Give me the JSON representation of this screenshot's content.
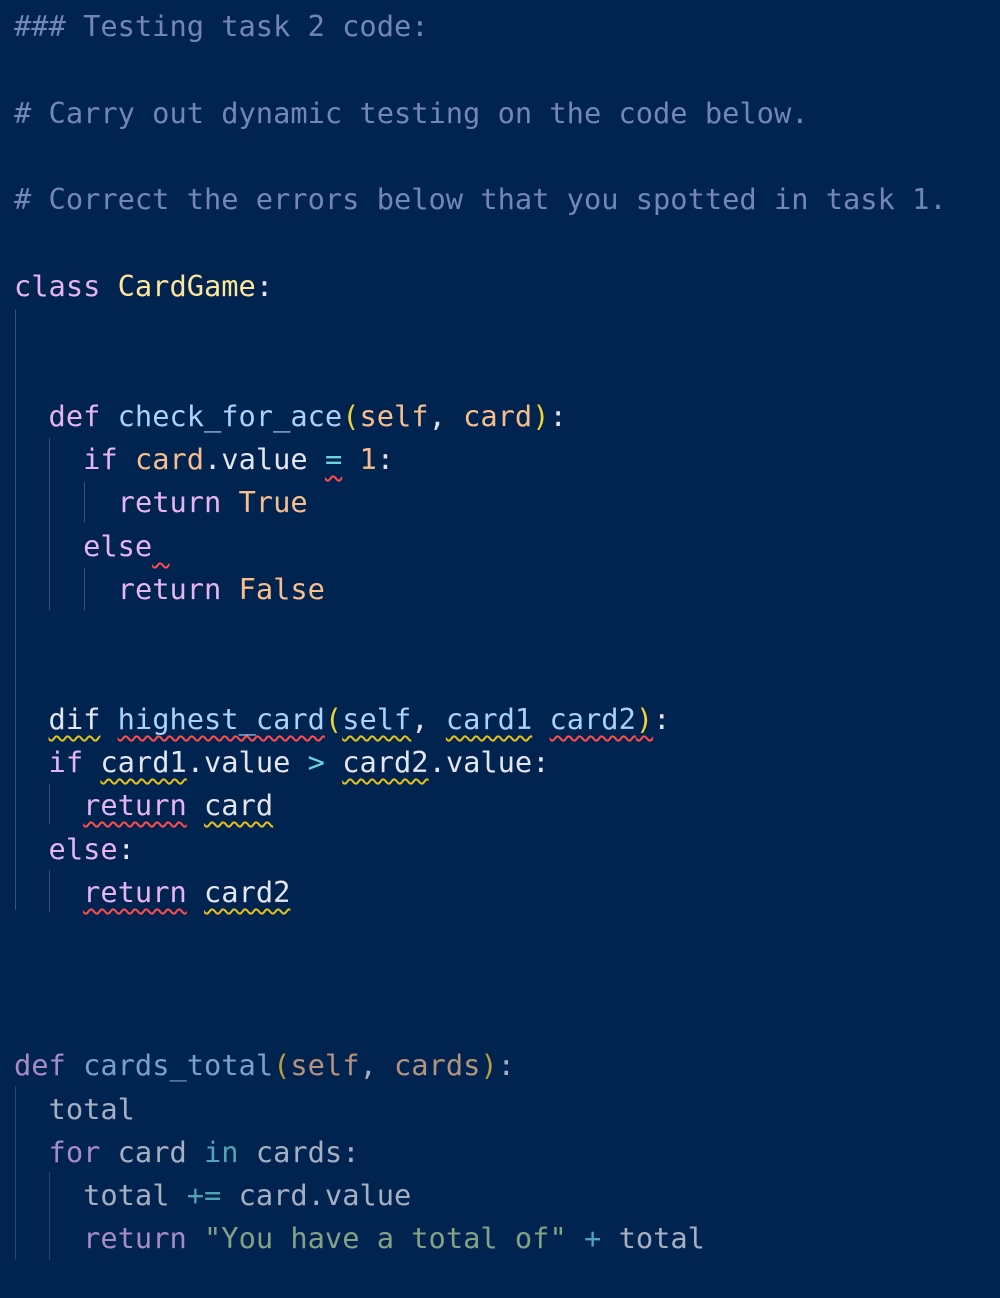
{
  "editor": {
    "lines": [
      {
        "row": 0,
        "indent": 0,
        "tokens": [
          {
            "t": "### Testing task 2 code:",
            "k": "comment"
          }
        ]
      },
      {
        "row": 2,
        "indent": 0,
        "tokens": [
          {
            "t": "# Carry out dynamic testing on the code below.",
            "k": "comment"
          }
        ]
      },
      {
        "row": 4,
        "indent": 0,
        "tokens": [
          {
            "t": "# Correct the errors below that you spotted in task 1.",
            "k": "comment"
          }
        ]
      },
      {
        "row": 6,
        "indent": 0,
        "tokens": [
          {
            "t": "class",
            "k": "kw"
          },
          {
            "t": " ",
            "k": "plain"
          },
          {
            "t": "CardGame",
            "k": "cls"
          },
          {
            "t": ":",
            "k": "plain"
          }
        ]
      },
      {
        "row": 9,
        "indent": 2,
        "tokens": [
          {
            "t": "def",
            "k": "kw"
          },
          {
            "t": " ",
            "k": "plain"
          },
          {
            "t": "check_for_ace",
            "k": "fn"
          },
          {
            "t": "(",
            "k": "paren"
          },
          {
            "t": "self",
            "k": "param"
          },
          {
            "t": ", ",
            "k": "plain"
          },
          {
            "t": "card",
            "k": "param"
          },
          {
            "t": ")",
            "k": "paren"
          },
          {
            "t": ":",
            "k": "plain"
          }
        ]
      },
      {
        "row": 10,
        "indent": 4,
        "tokens": [
          {
            "t": "if",
            "k": "kw"
          },
          {
            "t": " ",
            "k": "plain"
          },
          {
            "t": "card",
            "k": "param"
          },
          {
            "t": ".value ",
            "k": "plain"
          },
          {
            "t": "=",
            "k": "op",
            "d": "err"
          },
          {
            "t": " ",
            "k": "plain"
          },
          {
            "t": "1",
            "k": "num"
          },
          {
            "t": ":",
            "k": "plain"
          }
        ]
      },
      {
        "row": 11,
        "indent": 6,
        "tokens": [
          {
            "t": "return",
            "k": "kw"
          },
          {
            "t": " ",
            "k": "plain"
          },
          {
            "t": "True",
            "k": "const"
          }
        ]
      },
      {
        "row": 12,
        "indent": 4,
        "tokens": [
          {
            "t": "else",
            "k": "kw"
          },
          {
            "t": " ",
            "k": "plain",
            "d": "err"
          }
        ]
      },
      {
        "row": 13,
        "indent": 6,
        "tokens": [
          {
            "t": "return",
            "k": "kw"
          },
          {
            "t": " ",
            "k": "plain"
          },
          {
            "t": "False",
            "k": "const"
          }
        ]
      },
      {
        "row": 16,
        "indent": 2,
        "tokens": [
          {
            "t": "dif",
            "k": "plain",
            "d": "warn"
          },
          {
            "t": " ",
            "k": "plain"
          },
          {
            "t": "highest_card",
            "k": "fn",
            "d": "err"
          },
          {
            "t": "(",
            "k": "paren"
          },
          {
            "t": "self",
            "k": "fn",
            "d": "warn"
          },
          {
            "t": ", ",
            "k": "plain"
          },
          {
            "t": "card1",
            "k": "fn",
            "d": "warn"
          },
          {
            "t": " ",
            "k": "plain"
          },
          {
            "t": "card2",
            "k": "fn",
            "d": "err"
          },
          {
            "t": ")",
            "k": "paren",
            "d": "err"
          },
          {
            "t": ":",
            "k": "plain"
          }
        ]
      },
      {
        "row": 17,
        "indent": 2,
        "tokens": [
          {
            "t": "if",
            "k": "kw"
          },
          {
            "t": " ",
            "k": "plain"
          },
          {
            "t": "card1",
            "k": "plain",
            "d": "warn"
          },
          {
            "t": ".value ",
            "k": "plain"
          },
          {
            "t": ">",
            "k": "op"
          },
          {
            "t": " ",
            "k": "plain"
          },
          {
            "t": "card2",
            "k": "plain",
            "d": "warn"
          },
          {
            "t": ".value:",
            "k": "plain"
          }
        ]
      },
      {
        "row": 18,
        "indent": 4,
        "tokens": [
          {
            "t": "return",
            "k": "kw",
            "d": "err"
          },
          {
            "t": " ",
            "k": "plain"
          },
          {
            "t": "card",
            "k": "plain",
            "d": "warn"
          }
        ]
      },
      {
        "row": 19,
        "indent": 2,
        "tokens": [
          {
            "t": "else",
            "k": "kw"
          },
          {
            "t": ":",
            "k": "plain"
          }
        ]
      },
      {
        "row": 20,
        "indent": 4,
        "tokens": [
          {
            "t": "return",
            "k": "kw",
            "d": "err"
          },
          {
            "t": " ",
            "k": "plain"
          },
          {
            "t": "card2",
            "k": "plain",
            "d": "warn"
          }
        ]
      },
      {
        "row": 24,
        "indent": 0,
        "dim": true,
        "tokens": [
          {
            "t": "def",
            "k": "kw"
          },
          {
            "t": " ",
            "k": "plain"
          },
          {
            "t": "cards_total",
            "k": "fn"
          },
          {
            "t": "(",
            "k": "paren"
          },
          {
            "t": "self",
            "k": "param"
          },
          {
            "t": ", ",
            "k": "plain"
          },
          {
            "t": "cards",
            "k": "param"
          },
          {
            "t": ")",
            "k": "paren"
          },
          {
            "t": ":",
            "k": "plain"
          }
        ]
      },
      {
        "row": 25,
        "indent": 2,
        "dim": true,
        "tokens": [
          {
            "t": "total",
            "k": "plain"
          }
        ]
      },
      {
        "row": 26,
        "indent": 2,
        "dim": true,
        "tokens": [
          {
            "t": "for",
            "k": "kw"
          },
          {
            "t": " card ",
            "k": "plain"
          },
          {
            "t": "in",
            "k": "op"
          },
          {
            "t": " cards:",
            "k": "plain"
          }
        ]
      },
      {
        "row": 27,
        "indent": 4,
        "dim": true,
        "tokens": [
          {
            "t": "total ",
            "k": "plain"
          },
          {
            "t": "+=",
            "k": "op"
          },
          {
            "t": " card.value",
            "k": "plain"
          }
        ]
      },
      {
        "row": 28,
        "indent": 4,
        "dim": true,
        "tokens": [
          {
            "t": "return",
            "k": "kw"
          },
          {
            "t": " ",
            "k": "plain"
          },
          {
            "t": "\"You have a total of\"",
            "k": "str"
          },
          {
            "t": " ",
            "k": "plain"
          },
          {
            "t": "+",
            "k": "op"
          },
          {
            "t": " total",
            "k": "plain"
          }
        ]
      }
    ]
  }
}
